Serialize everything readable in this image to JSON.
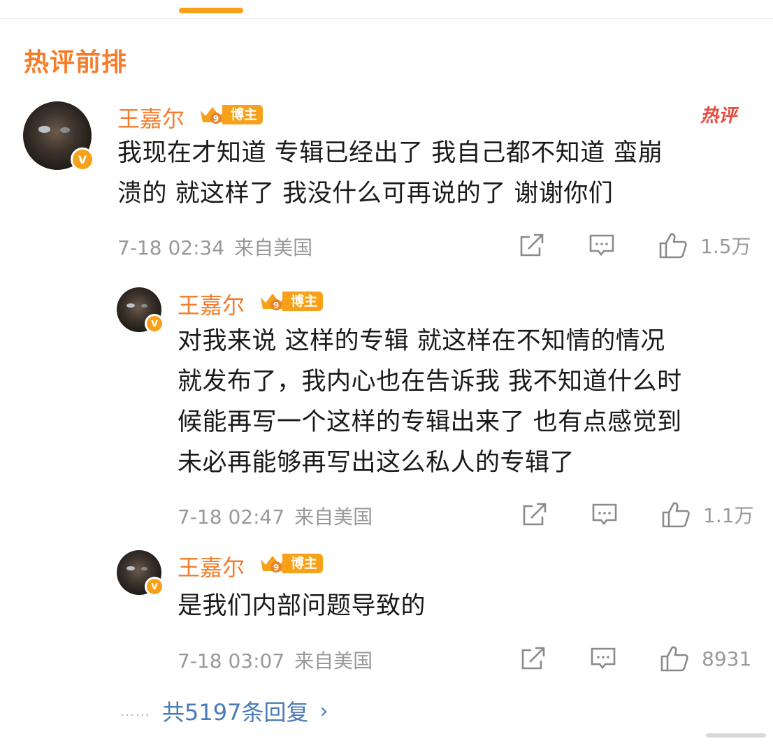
{
  "section_title": "热评前排",
  "hot_tag": "热评",
  "comments": [
    {
      "name": "王嘉尔",
      "badge": "博主",
      "crown_num": "9",
      "verified": "V",
      "content_lines": [
        "我现在才知道 专辑已经出了 我自己都不知道 蛮崩",
        "溃的  就这样了 我没什么可再说的了  谢谢你们"
      ],
      "time": "7-18 02:34",
      "location": "来自美国",
      "likes": "1.5万"
    },
    {
      "name": "王嘉尔",
      "badge": "博主",
      "crown_num": "9",
      "verified": "V",
      "content_lines": [
        "对我来说 这样的专辑 就这样在不知情的情况",
        "就发布了，我内心也在告诉我 我不知道什么时",
        "候能再写一个这样的专辑出来了 也有点感觉到",
        "未必再能够再写出这么私人的专辑了"
      ],
      "time": "7-18 02:47",
      "location": "来自美国",
      "likes": "1.1万"
    },
    {
      "name": "王嘉尔",
      "badge": "博主",
      "crown_num": "9",
      "verified": "V",
      "content_lines": [
        "是我们内部问题导致的"
      ],
      "time": "7-18 03:07",
      "location": "来自美国",
      "likes": "8931"
    }
  ],
  "more": {
    "dots": "……",
    "label": "共5197条回复",
    "chevron": "›"
  },
  "colors": {
    "accent": "#f47c2a",
    "badge": "#f7a11a",
    "link": "#4a7ab8",
    "meta": "#999999",
    "hot": "#e8493b"
  }
}
